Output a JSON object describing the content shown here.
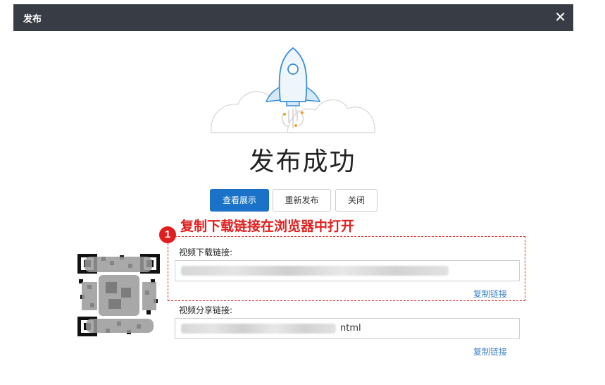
{
  "dialog": {
    "title": "发布",
    "close_label": "✕"
  },
  "success": {
    "title": "发布成功"
  },
  "buttons": {
    "view": "查看展示",
    "republish": "重新发布",
    "close": "关闭"
  },
  "annotation": {
    "number": "1",
    "text": "复制下载链接在浏览器中打开",
    "color": "#e02020"
  },
  "download": {
    "label": "视频下载链接:",
    "value": "",
    "copy_label": "复制链接"
  },
  "share": {
    "label": "视频分享链接:",
    "value_visible_suffix": "ntml",
    "copy_label": "复制链接"
  },
  "colors": {
    "titlebar": "#383d45",
    "primary": "#1a73c8",
    "link": "#3a7fc8"
  }
}
